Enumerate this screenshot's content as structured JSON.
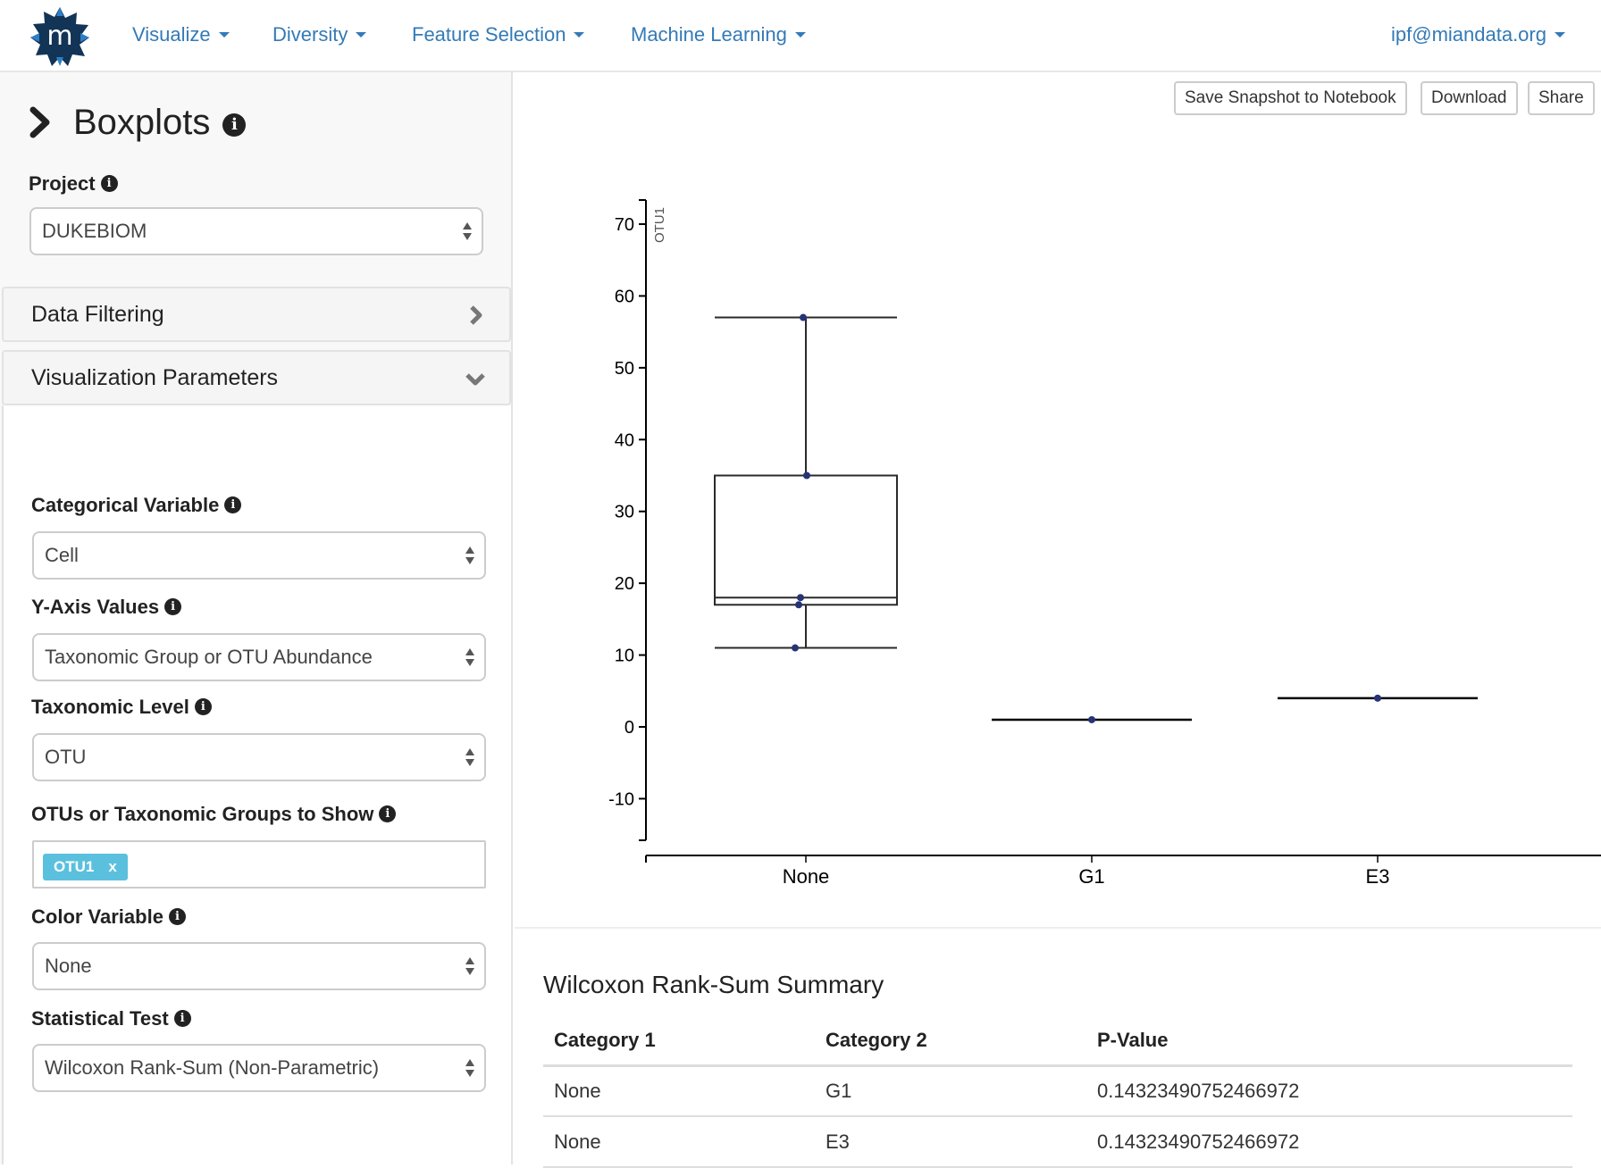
{
  "navbar": {
    "logo_letter": "m",
    "items": [
      {
        "label": "Visualize",
        "icon": "caret-down-icon"
      },
      {
        "label": "Diversity",
        "icon": "caret-down-icon"
      },
      {
        "label": "Feature Selection",
        "icon": "caret-down-icon"
      },
      {
        "label": "Machine Learning",
        "icon": "caret-down-icon"
      }
    ],
    "user": {
      "label": "ipf@miandata.org",
      "icon": "caret-down-icon"
    },
    "link_color": "#337ab7"
  },
  "sidebar": {
    "title": "Boxplots",
    "title_icon": "chevron-right-icon",
    "info_glyph": "i",
    "project": {
      "label": "Project",
      "value": "DUKEBIOM"
    },
    "panels": [
      {
        "label": "Data Filtering",
        "icon": "chevron-right-icon",
        "expanded": false
      },
      {
        "label": "Visualization Parameters",
        "icon": "chevron-down-icon",
        "expanded": true
      }
    ],
    "fields": {
      "categorical_variable": {
        "label": "Categorical Variable",
        "value": "Cell"
      },
      "y_axis_values": {
        "label": "Y-Axis Values",
        "value": "Taxonomic Group or OTU Abundance"
      },
      "taxonomic_level": {
        "label": "Taxonomic Level",
        "value": "OTU"
      },
      "otus_to_show": {
        "label": "OTUs or Taxonomic Groups to Show",
        "tags": [
          {
            "label": "OTU1",
            "remove": "x"
          }
        ]
      },
      "color_variable": {
        "label": "Color Variable",
        "value": "None"
      },
      "statistical_test": {
        "label": "Statistical Test",
        "value": "Wilcoxon Rank-Sum (Non-Parametric)"
      }
    },
    "tag_color": "#5bc0de"
  },
  "toolbar": {
    "save_label": "Save Snapshot to Notebook",
    "download_label": "Download",
    "share_label": "Share"
  },
  "chart_data": {
    "type": "boxplot",
    "title": "",
    "xlabel": "",
    "ylabel": "OTU1",
    "categories": [
      "None",
      "G1",
      "E3"
    ],
    "yticks": [
      -10,
      0,
      10,
      20,
      30,
      40,
      50,
      60,
      70
    ],
    "ylim": [
      -16,
      73
    ],
    "grid": false,
    "point_color": "#263475",
    "boxes": [
      {
        "category": "None",
        "min": 11,
        "q1": 17,
        "median": 18,
        "q3": 35,
        "max": 57,
        "points": [
          57,
          35,
          18,
          17,
          11
        ]
      },
      {
        "category": "G1",
        "min": 1,
        "q1": 1,
        "median": 1,
        "q3": 1,
        "max": 1,
        "points": [
          1
        ]
      },
      {
        "category": "E3",
        "min": 4,
        "q1": 4,
        "median": 4,
        "q3": 4,
        "max": 4,
        "points": [
          4
        ]
      }
    ]
  },
  "summary": {
    "title": "Wilcoxon Rank-Sum Summary",
    "columns": [
      "Category 1",
      "Category 2",
      "P-Value"
    ],
    "rows": [
      [
        "None",
        "G1",
        "0.14323490752466972"
      ],
      [
        "None",
        "E3",
        "0.14323490752466972"
      ]
    ]
  }
}
